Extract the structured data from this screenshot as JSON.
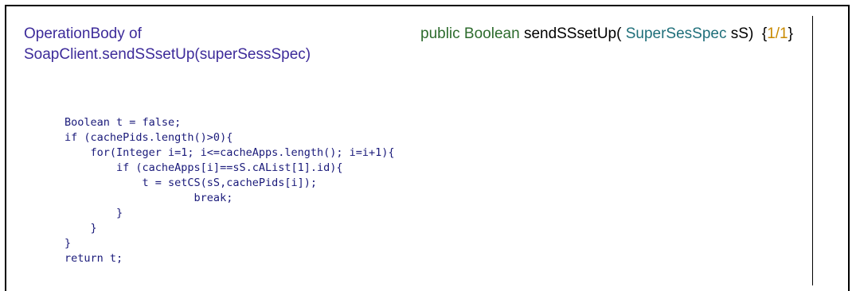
{
  "operation": {
    "title_line1": "OperationBody of",
    "title_line2": "SoapClient.sendSSsetUp(superSessSpec)"
  },
  "signature": {
    "keyword": "public Boolean",
    "method": "sendSSsetUp(",
    "param_type": "SuperSesSpec",
    "param_name": "sS)",
    "brace": "{",
    "page": "1/1",
    "close": "}"
  },
  "code_lines": [
    "Boolean t = false;",
    "if (cachePids.length()>0){",
    "    for(Integer i=1; i<=cacheApps.length(); i=i+1){",
    "        if (cacheApps[i]==sS.cAList[1].id){",
    "            t = setCS(sS,cachePids[i]);",
    "                    break;",
    "        }",
    "    }",
    "}",
    "return t;"
  ],
  "colors": {
    "title": "#3d2b9a",
    "keyword": "#2d6b2d",
    "type": "#1f6f7a",
    "code": "#1a1a7a",
    "page_counter": "#c98a00"
  }
}
